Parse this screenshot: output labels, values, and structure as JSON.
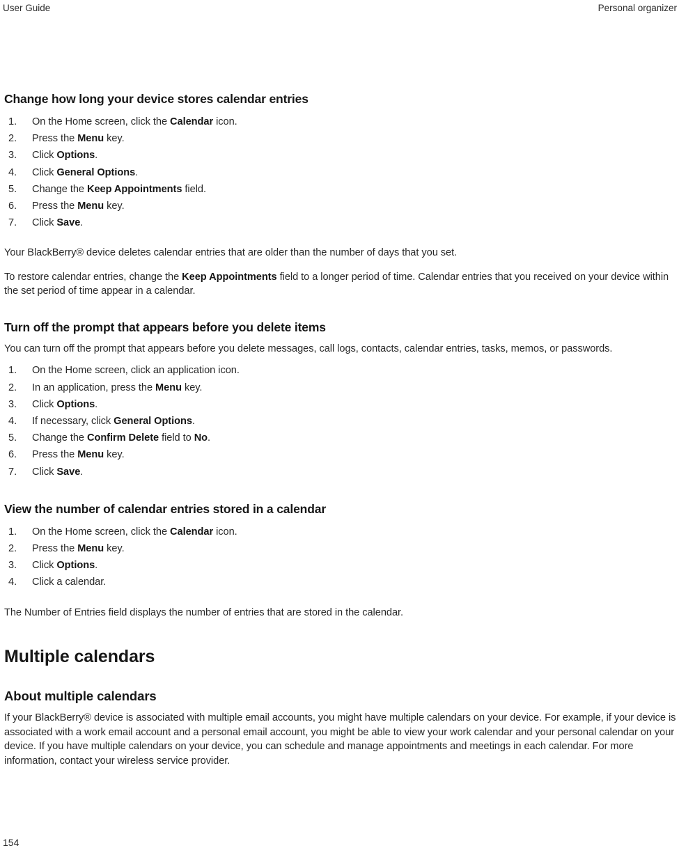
{
  "header": {
    "left": "User Guide",
    "right": "Personal organizer"
  },
  "footer": {
    "page_number": "154"
  },
  "sections": [
    {
      "heading": "Change how long your device stores calendar entries",
      "steps": [
        {
          "num": "1.",
          "parts": [
            {
              "t": "On the Home screen, click the ",
              "b": false
            },
            {
              "t": "Calendar",
              "b": true
            },
            {
              "t": " icon.",
              "b": false
            }
          ]
        },
        {
          "num": "2.",
          "parts": [
            {
              "t": "Press the ",
              "b": false
            },
            {
              "t": "Menu",
              "b": true
            },
            {
              "t": " key.",
              "b": false
            }
          ]
        },
        {
          "num": "3.",
          "parts": [
            {
              "t": "Click ",
              "b": false
            },
            {
              "t": "Options",
              "b": true
            },
            {
              "t": ".",
              "b": false
            }
          ]
        },
        {
          "num": "4.",
          "parts": [
            {
              "t": "Click ",
              "b": false
            },
            {
              "t": "General Options",
              "b": true
            },
            {
              "t": ".",
              "b": false
            }
          ]
        },
        {
          "num": "5.",
          "parts": [
            {
              "t": "Change the ",
              "b": false
            },
            {
              "t": "Keep Appointments",
              "b": true
            },
            {
              "t": " field.",
              "b": false
            }
          ]
        },
        {
          "num": "6.",
          "parts": [
            {
              "t": "Press the ",
              "b": false
            },
            {
              "t": "Menu",
              "b": true
            },
            {
              "t": " key.",
              "b": false
            }
          ]
        },
        {
          "num": "7.",
          "parts": [
            {
              "t": "Click ",
              "b": false
            },
            {
              "t": "Save",
              "b": true
            },
            {
              "t": ".",
              "b": false
            }
          ]
        }
      ],
      "paragraphs": [
        [
          {
            "t": "Your BlackBerry® device deletes calendar entries that are older than the number of days that you set.",
            "b": false
          }
        ],
        [
          {
            "t": "To restore calendar entries, change the ",
            "b": false
          },
          {
            "t": "Keep Appointments",
            "b": true
          },
          {
            "t": " field to a longer period of time. Calendar entries that you received on your device within the set period of time appear in a calendar.",
            "b": false
          }
        ]
      ]
    },
    {
      "heading": "Turn off the prompt that appears before you delete items",
      "intro": [
        {
          "t": "You can turn off the prompt that appears before you delete messages, call logs, contacts, calendar entries, tasks, memos, or passwords.",
          "b": false
        }
      ],
      "steps": [
        {
          "num": "1.",
          "parts": [
            {
              "t": "On the Home screen, click an application icon.",
              "b": false
            }
          ]
        },
        {
          "num": "2.",
          "parts": [
            {
              "t": "In an application, press the ",
              "b": false
            },
            {
              "t": "Menu",
              "b": true
            },
            {
              "t": " key.",
              "b": false
            }
          ]
        },
        {
          "num": "3.",
          "parts": [
            {
              "t": "Click ",
              "b": false
            },
            {
              "t": "Options",
              "b": true
            },
            {
              "t": ".",
              "b": false
            }
          ]
        },
        {
          "num": "4.",
          "parts": [
            {
              "t": "If necessary, click ",
              "b": false
            },
            {
              "t": "General Options",
              "b": true
            },
            {
              "t": ".",
              "b": false
            }
          ]
        },
        {
          "num": "5.",
          "parts": [
            {
              "t": "Change the ",
              "b": false
            },
            {
              "t": "Confirm Delete",
              "b": true
            },
            {
              "t": " field to ",
              "b": false
            },
            {
              "t": "No",
              "b": true
            },
            {
              "t": ".",
              "b": false
            }
          ]
        },
        {
          "num": "6.",
          "parts": [
            {
              "t": "Press the ",
              "b": false
            },
            {
              "t": "Menu",
              "b": true
            },
            {
              "t": " key.",
              "b": false
            }
          ]
        },
        {
          "num": "7.",
          "parts": [
            {
              "t": "Click ",
              "b": false
            },
            {
              "t": "Save",
              "b": true
            },
            {
              "t": ".",
              "b": false
            }
          ]
        }
      ]
    },
    {
      "heading": "View the number of calendar entries stored in a calendar",
      "steps": [
        {
          "num": "1.",
          "parts": [
            {
              "t": "On the Home screen, click the ",
              "b": false
            },
            {
              "t": "Calendar",
              "b": true
            },
            {
              "t": " icon.",
              "b": false
            }
          ]
        },
        {
          "num": "2.",
          "parts": [
            {
              "t": "Press the ",
              "b": false
            },
            {
              "t": "Menu",
              "b": true
            },
            {
              "t": " key.",
              "b": false
            }
          ]
        },
        {
          "num": "3.",
          "parts": [
            {
              "t": "Click ",
              "b": false
            },
            {
              "t": "Options",
              "b": true
            },
            {
              "t": ".",
              "b": false
            }
          ]
        },
        {
          "num": "4.",
          "parts": [
            {
              "t": "Click a calendar.",
              "b": false
            }
          ]
        }
      ],
      "paragraphs": [
        [
          {
            "t": "The Number of Entries field displays the number of entries that are stored in the calendar.",
            "b": false
          }
        ]
      ]
    }
  ],
  "chapter": {
    "title": "Multiple calendars",
    "subhead": "About multiple calendars",
    "body": [
      {
        "t": "If your BlackBerry® device is associated with multiple email accounts, you might have multiple calendars on your device. For example, if your device is associated with a work email account and a personal email account, you might be able to view your work calendar and your personal calendar on your device. If you have multiple calendars on your device, you can schedule and manage appointments and meetings in each calendar. For more information, contact your wireless service provider.",
        "b": false
      }
    ]
  }
}
